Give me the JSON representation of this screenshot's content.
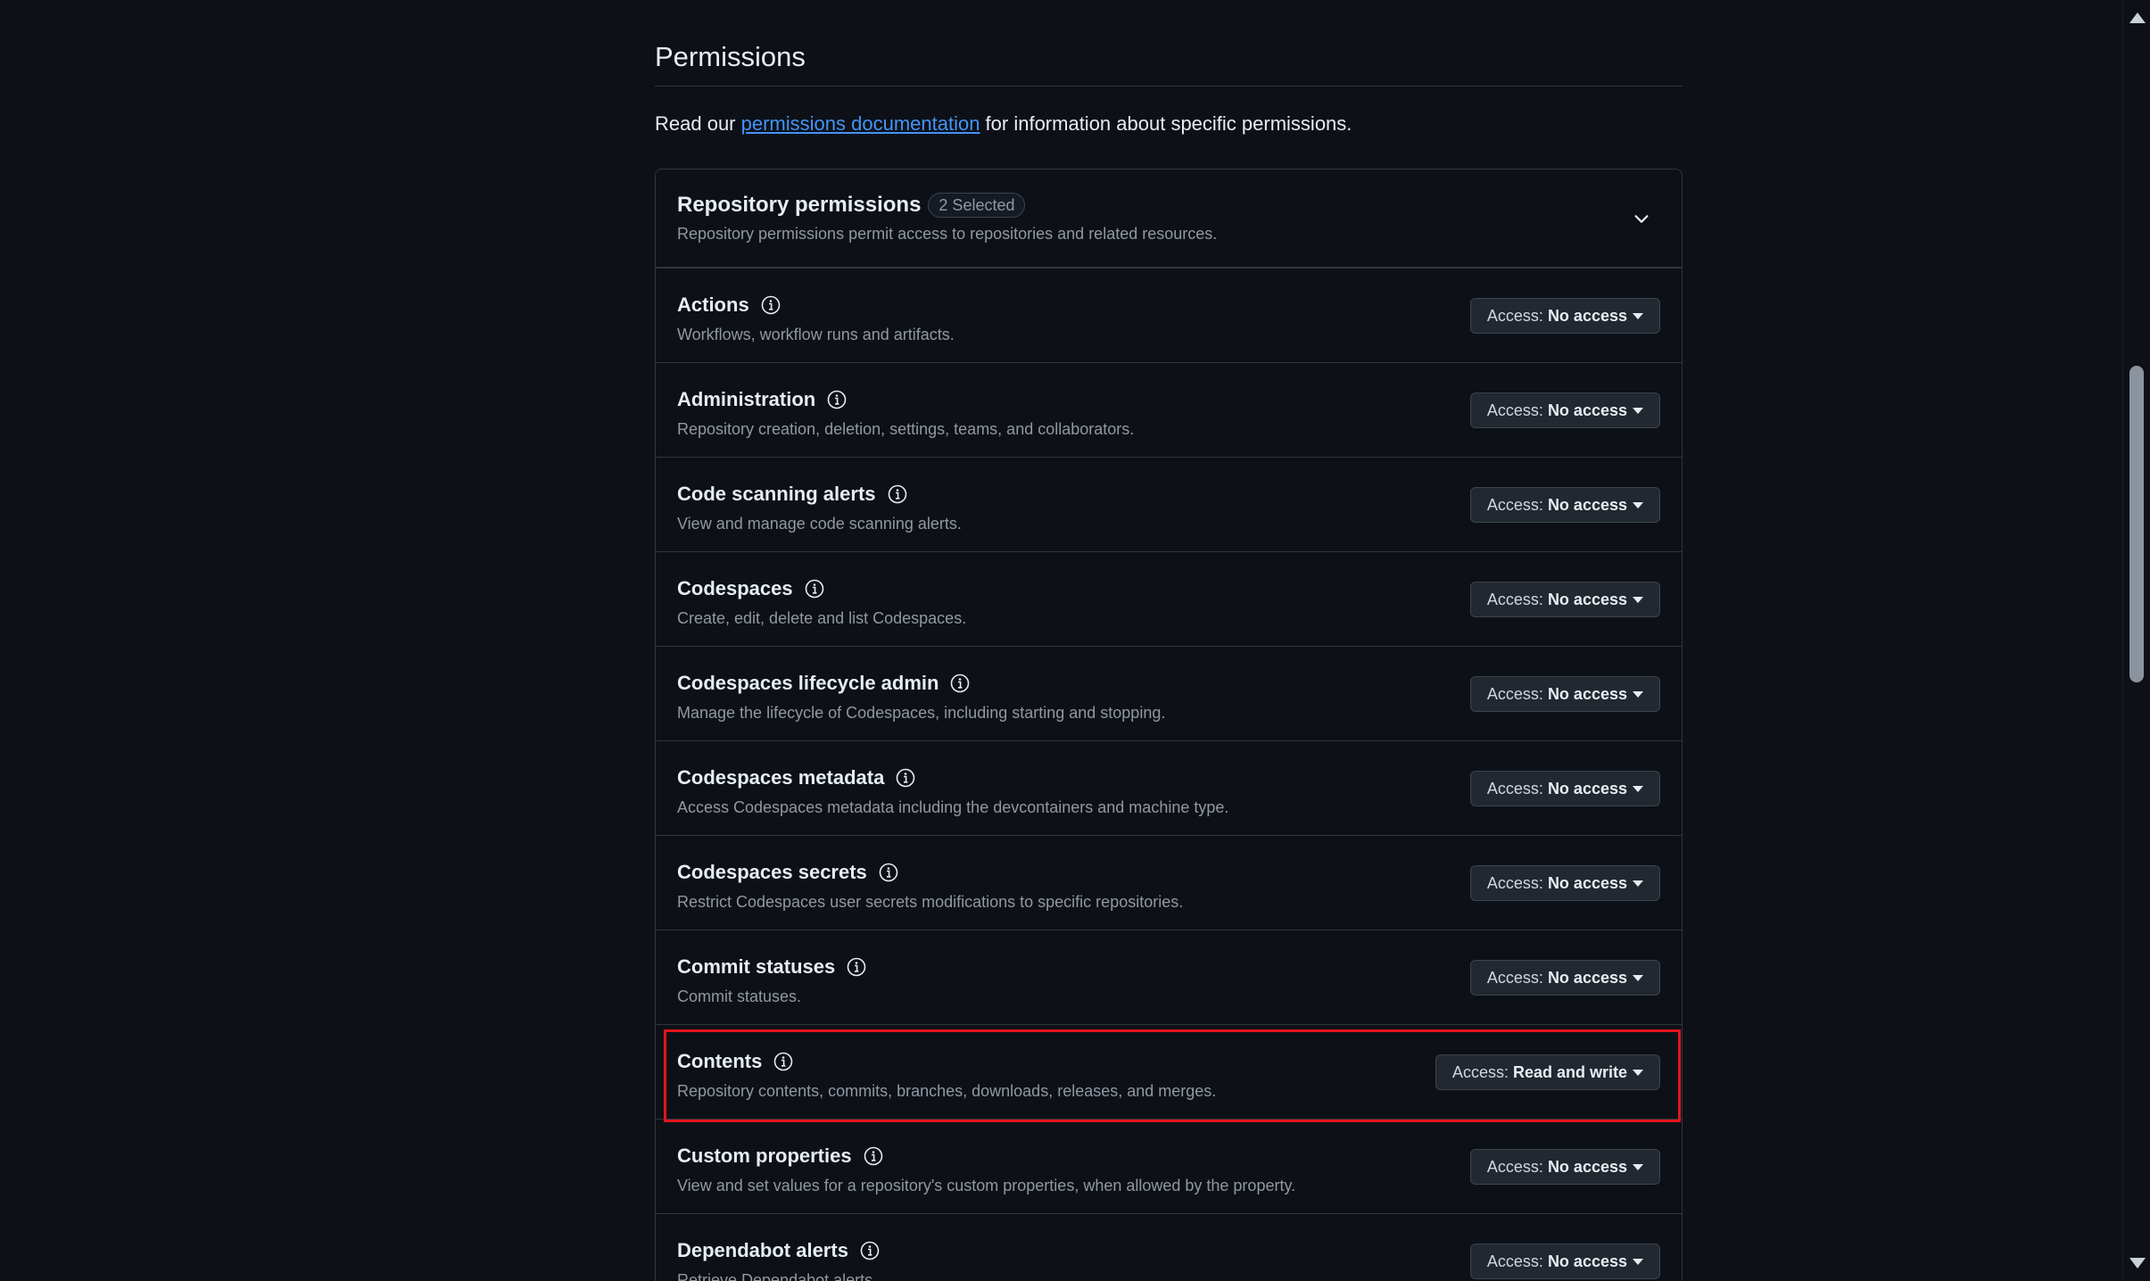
{
  "section": {
    "title": "Permissions",
    "intro_before": "Read our ",
    "intro_link": "permissions documentation",
    "intro_after": " for information about specific permissions."
  },
  "panel": {
    "title": "Repository permissions",
    "badge": "2 Selected",
    "description": "Repository permissions permit access to repositories and related resources."
  },
  "access_prefix": "Access:",
  "permissions": [
    {
      "name": "Actions",
      "description": "Workflows, workflow runs and artifacts.",
      "access": "No access"
    },
    {
      "name": "Administration",
      "description": "Repository creation, deletion, settings, teams, and collaborators.",
      "access": "No access"
    },
    {
      "name": "Code scanning alerts",
      "description": "View and manage code scanning alerts.",
      "access": "No access"
    },
    {
      "name": "Codespaces",
      "description": "Create, edit, delete and list Codespaces.",
      "access": "No access"
    },
    {
      "name": "Codespaces lifecycle admin",
      "description": "Manage the lifecycle of Codespaces, including starting and stopping.",
      "access": "No access"
    },
    {
      "name": "Codespaces metadata",
      "description": "Access Codespaces metadata including the devcontainers and machine type.",
      "access": "No access"
    },
    {
      "name": "Codespaces secrets",
      "description": "Restrict Codespaces user secrets modifications to specific repositories.",
      "access": "No access"
    },
    {
      "name": "Commit statuses",
      "description": "Commit statuses.",
      "access": "No access"
    },
    {
      "name": "Contents",
      "description": "Repository contents, commits, branches, downloads, releases, and merges.",
      "access": "Read and write"
    },
    {
      "name": "Custom properties",
      "description": "View and set values for a repository's custom properties, when allowed by the property.",
      "access": "No access"
    },
    {
      "name": "Dependabot alerts",
      "description": "Retrieve Dependabot alerts.",
      "access": "No access"
    }
  ],
  "colors": {
    "background": "#0d1117",
    "link": "#4493f8",
    "highlight": "#e5131b",
    "border": "#30363d"
  }
}
